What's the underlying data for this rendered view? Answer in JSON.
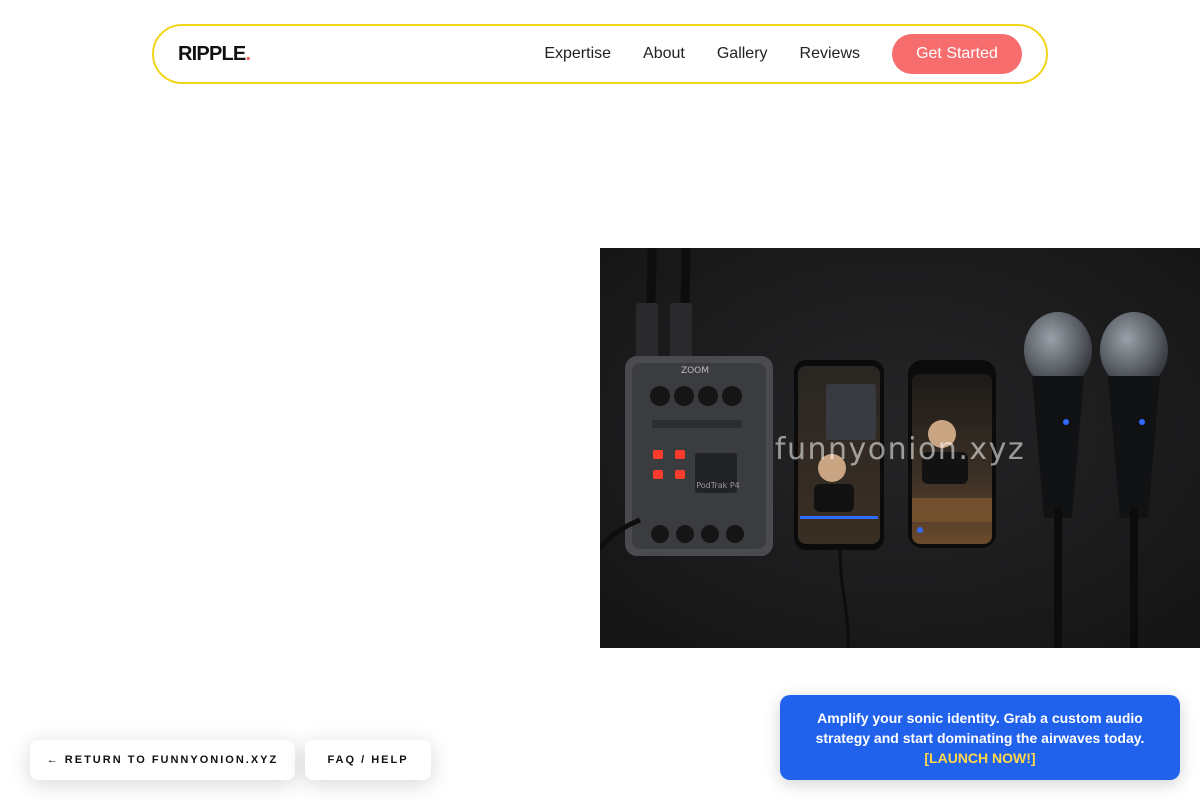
{
  "header": {
    "logo_text": "RIPPLE",
    "logo_dot": ".",
    "nav": [
      {
        "label": "Expertise"
      },
      {
        "label": "About"
      },
      {
        "label": "Gallery"
      },
      {
        "label": "Reviews"
      }
    ],
    "cta_label": "Get Started"
  },
  "hero": {
    "image_alt": "Podcast recorder, two smartphones and two microphones on a dark background",
    "watermark": "funnyonion.xyz"
  },
  "footer_buttons": {
    "return_label": "← RETURN TO FUNNYONION.XYZ",
    "faq_label": "FAQ / HELP"
  },
  "promo": {
    "message": "Amplify your sonic identity. Grab a custom audio strategy and start dominating the airwaves today.",
    "link_label": "[LAUNCH NOW!]"
  },
  "colors": {
    "nav_border": "#f2d51d",
    "cta_bg": "#f76d6d",
    "logo_dot": "#f0645f",
    "promo_bg": "#2162ed",
    "promo_link": "#ffd84a"
  }
}
